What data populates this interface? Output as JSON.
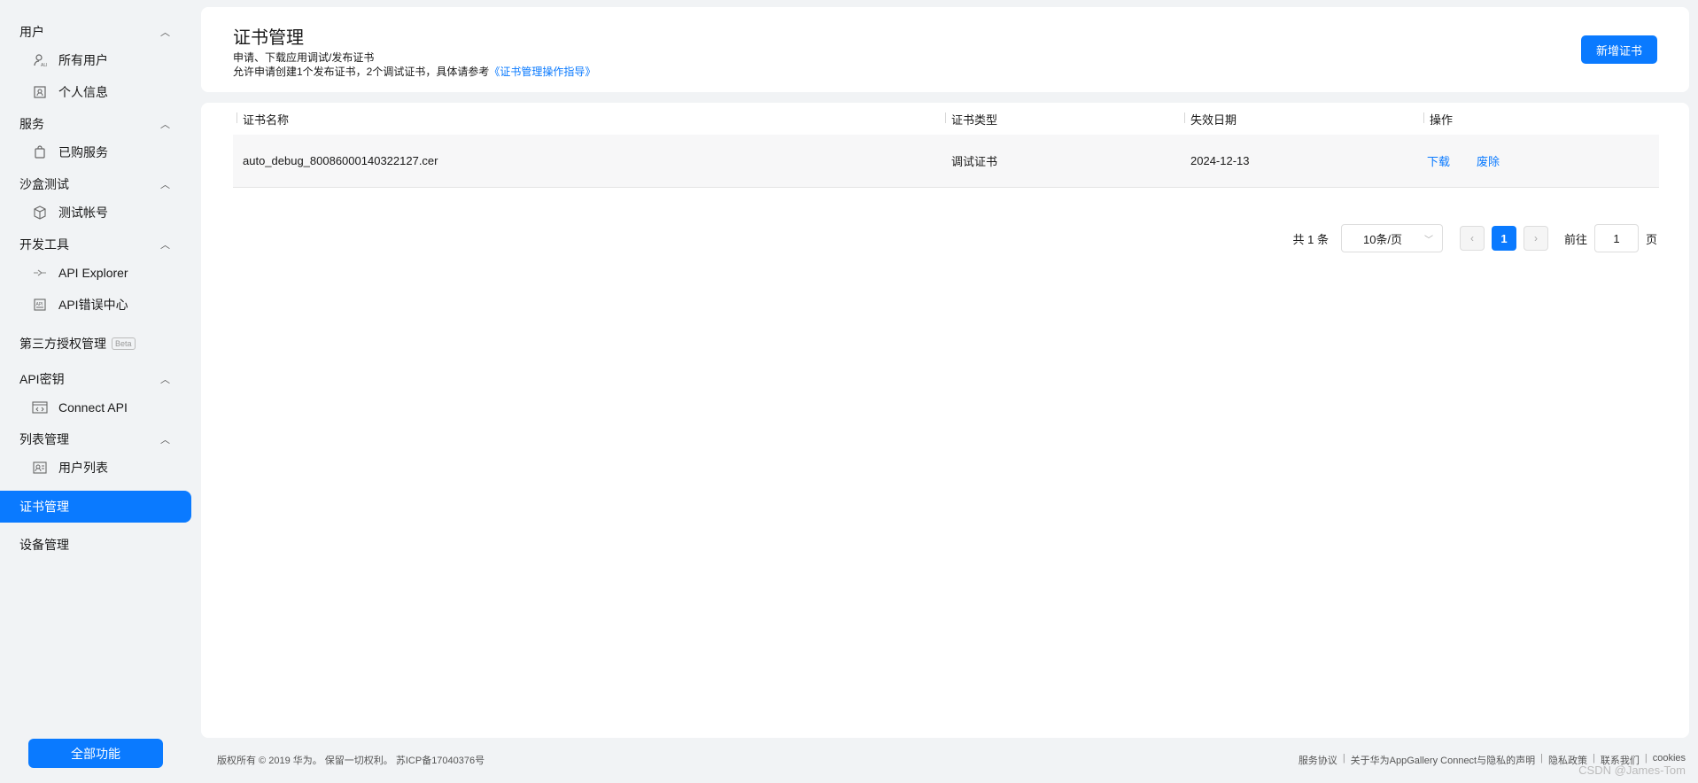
{
  "sidebar": {
    "groups": [
      {
        "title": "用户",
        "items": [
          {
            "label": "所有用户",
            "icon": "user-all-icon"
          },
          {
            "label": "个人信息",
            "icon": "profile-icon"
          }
        ]
      },
      {
        "title": "服务",
        "items": [
          {
            "label": "已购服务",
            "icon": "bag-icon"
          }
        ]
      },
      {
        "title": "沙盒测试",
        "items": [
          {
            "label": "测试帐号",
            "icon": "cube-icon"
          }
        ]
      },
      {
        "title": "开发工具",
        "items": [
          {
            "label": "API Explorer",
            "icon": "plug-icon"
          },
          {
            "label": "API错误中心",
            "icon": "error-center-icon"
          }
        ]
      }
    ],
    "third_party": "第三方授权管理",
    "beta": "Beta",
    "api_key_group": {
      "title": "API密钥",
      "items": [
        {
          "label": "Connect API",
          "icon": "code-window-icon"
        }
      ]
    },
    "list_group": {
      "title": "列表管理",
      "items": [
        {
          "label": "用户列表",
          "icon": "user-list-icon"
        }
      ]
    },
    "cert_manage": "证书管理",
    "device_manage": "设备管理",
    "all_functions": "全部功能"
  },
  "header": {
    "title": "证书管理",
    "desc1": "申请、下载应用调试/发布证书",
    "desc2_prefix": "允许申请创建1个发布证书，2个调试证书，具体请参考",
    "desc2_link": "《证书管理操作指导》",
    "add_button": "新增证书"
  },
  "table": {
    "headers": [
      "证书名称",
      "证书类型",
      "失效日期",
      "操作"
    ],
    "rows": [
      {
        "name": "auto_debug_80086000140322127.cer",
        "type": "调试证书",
        "expiry": "2024-12-13",
        "actions": [
          "下载",
          "废除"
        ]
      }
    ]
  },
  "pager": {
    "total": "共 1 条",
    "page_size": "10条/页",
    "current_page": "1",
    "goto_label": "前往",
    "goto_value": "1",
    "page_suffix": "页"
  },
  "footer": {
    "copyright": "版权所有 © 2019 华为。 保留一切权利。 苏ICP备17040376号",
    "links": [
      "服务协议",
      "关于华为AppGallery Connect与隐私的声明",
      "隐私政策",
      "联系我们",
      "cookies"
    ],
    "watermark": "CSDN @James-Tom"
  },
  "colors": {
    "accent": "#0a7aff"
  }
}
